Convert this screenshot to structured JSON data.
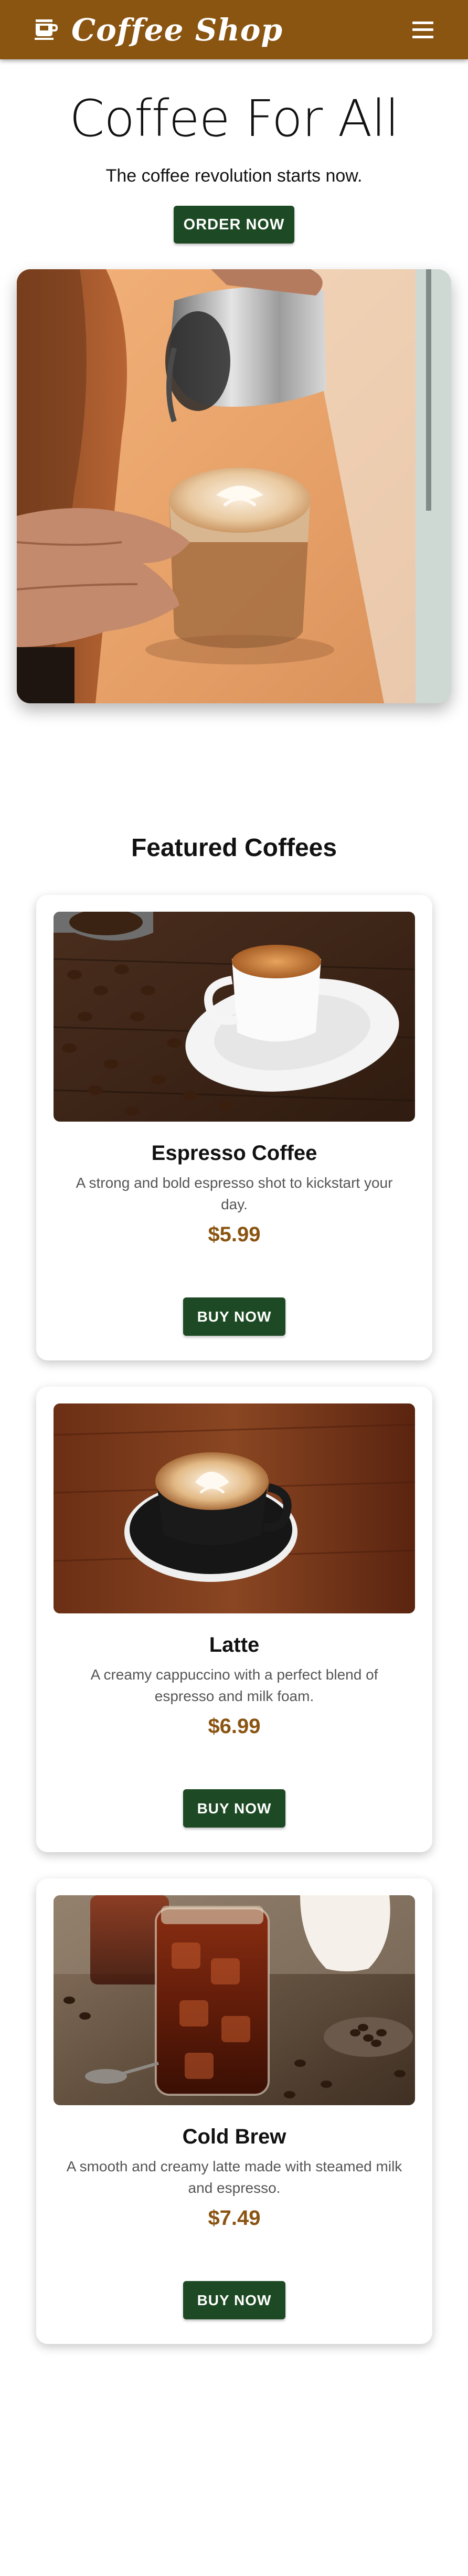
{
  "header": {
    "brand_name": "Coffee Shop",
    "brand_icon": "coffee-cup-icon",
    "menu_icon": "hamburger-menu-icon"
  },
  "hero": {
    "title": "Coffee For All",
    "subtitle": "The coffee revolution starts now.",
    "cta_label": "ORDER NOW",
    "image": "barista-pouring-latte-art-photo"
  },
  "featured": {
    "title": "Featured Coffees",
    "items": [
      {
        "name": "Espresso Coffee",
        "description": "A strong and bold espresso shot to kickstart your day.",
        "price": "$5.99",
        "button_label": "BUY NOW",
        "image": "espresso-cup-coffee-beans-photo"
      },
      {
        "name": "Latte",
        "description": "A creamy cappuccino with a perfect blend of espresso and milk foam.",
        "price": "$6.99",
        "button_label": "BUY NOW",
        "image": "latte-art-cup-photo"
      },
      {
        "name": "Cold Brew",
        "description": "A smooth and creamy latte made with steamed milk and espresso.",
        "price": "$7.49",
        "button_label": "BUY NOW",
        "image": "iced-cold-brew-jar-photo"
      }
    ]
  },
  "colors": {
    "header_bg": "#8a5411",
    "button_bg": "#1d4a24",
    "price_color": "#8a5411"
  }
}
